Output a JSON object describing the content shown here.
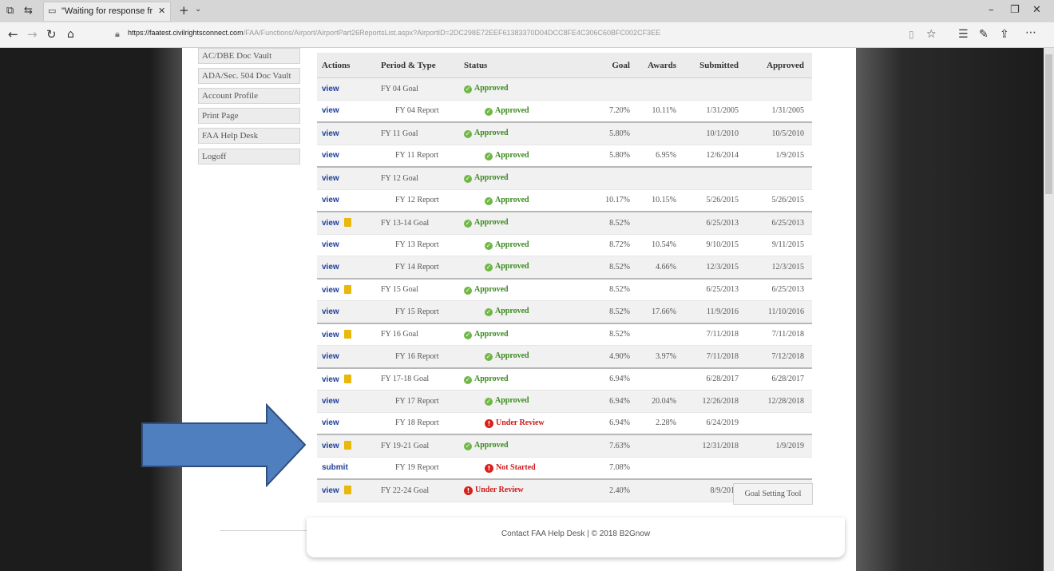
{
  "browser": {
    "tab_title": "\"Waiting for response fr",
    "url_host": "https://faatest.civilrightsconnect.com",
    "url_path": "/FAA/Functions/Airport/AirportPart26ReportsList.aspx?AirportID=2DC298E72EEF61383370D04DCC8FE4C306C60BFC002CF3EE"
  },
  "side_menu": {
    "items": [
      "AC/DBE Doc Vault",
      "ADA/Sec. 504 Doc Vault",
      "Account Profile",
      "Print Page",
      "FAA Help Desk",
      "Logoff"
    ]
  },
  "table": {
    "headers": [
      "Actions",
      "Period & Type",
      "Status",
      "Goal",
      "Awards",
      "Submitted",
      "Approved"
    ],
    "rows": [
      {
        "action": "view",
        "doc": false,
        "period": "FY 04 Goal",
        "indent": false,
        "status": "Approved",
        "state": "ok",
        "goal": "",
        "awards": "",
        "submitted": "",
        "approved": ""
      },
      {
        "action": "view",
        "doc": false,
        "period": "FY 04 Report",
        "indent": true,
        "status": "Approved",
        "state": "ok",
        "goal": "7.20%",
        "awards": "10.11%",
        "submitted": "1/31/2005",
        "approved": "1/31/2005"
      },
      {
        "action": "view",
        "doc": false,
        "period": "FY 11 Goal",
        "indent": false,
        "status": "Approved",
        "state": "ok",
        "goal": "5.80%",
        "awards": "",
        "submitted": "10/1/2010",
        "approved": "10/5/2010"
      },
      {
        "action": "view",
        "doc": false,
        "period": "FY 11 Report",
        "indent": true,
        "status": "Approved",
        "state": "ok",
        "goal": "5.80%",
        "awards": "6.95%",
        "submitted": "12/6/2014",
        "approved": "1/9/2015"
      },
      {
        "action": "view",
        "doc": false,
        "period": "FY 12 Goal",
        "indent": false,
        "status": "Approved",
        "state": "ok",
        "goal": "",
        "awards": "",
        "submitted": "",
        "approved": ""
      },
      {
        "action": "view",
        "doc": false,
        "period": "FY 12 Report",
        "indent": true,
        "status": "Approved",
        "state": "ok",
        "goal": "10.17%",
        "awards": "10.15%",
        "submitted": "5/26/2015",
        "approved": "5/26/2015"
      },
      {
        "action": "view",
        "doc": true,
        "period": "FY 13-14 Goal",
        "indent": false,
        "status": "Approved",
        "state": "ok",
        "goal": "8.52%",
        "awards": "",
        "submitted": "6/25/2013",
        "approved": "6/25/2013"
      },
      {
        "action": "view",
        "doc": false,
        "period": "FY 13 Report",
        "indent": true,
        "status": "Approved",
        "state": "ok",
        "goal": "8.72%",
        "awards": "10.54%",
        "submitted": "9/10/2015",
        "approved": "9/11/2015"
      },
      {
        "action": "view",
        "doc": false,
        "period": "FY 14 Report",
        "indent": true,
        "status": "Approved",
        "state": "ok",
        "goal": "8.52%",
        "awards": "4.66%",
        "submitted": "12/3/2015",
        "approved": "12/3/2015"
      },
      {
        "action": "view",
        "doc": true,
        "period": "FY 15 Goal",
        "indent": false,
        "status": "Approved",
        "state": "ok",
        "goal": "8.52%",
        "awards": "",
        "submitted": "6/25/2013",
        "approved": "6/25/2013"
      },
      {
        "action": "view",
        "doc": false,
        "period": "FY 15 Report",
        "indent": true,
        "status": "Approved",
        "state": "ok",
        "goal": "8.52%",
        "awards": "17.66%",
        "submitted": "11/9/2016",
        "approved": "11/10/2016"
      },
      {
        "action": "view",
        "doc": true,
        "period": "FY 16 Goal",
        "indent": false,
        "status": "Approved",
        "state": "ok",
        "goal": "8.52%",
        "awards": "",
        "submitted": "7/11/2018",
        "approved": "7/11/2018"
      },
      {
        "action": "view",
        "doc": false,
        "period": "FY 16 Report",
        "indent": true,
        "status": "Approved",
        "state": "ok",
        "goal": "4.90%",
        "awards": "3.97%",
        "submitted": "7/11/2018",
        "approved": "7/12/2018"
      },
      {
        "action": "view",
        "doc": true,
        "period": "FY 17-18 Goal",
        "indent": false,
        "status": "Approved",
        "state": "ok",
        "goal": "6.94%",
        "awards": "",
        "submitted": "6/28/2017",
        "approved": "6/28/2017"
      },
      {
        "action": "view",
        "doc": false,
        "period": "FY 17 Report",
        "indent": true,
        "status": "Approved",
        "state": "ok",
        "goal": "6.94%",
        "awards": "20.04%",
        "submitted": "12/26/2018",
        "approved": "12/28/2018"
      },
      {
        "action": "view",
        "doc": false,
        "period": "FY 18 Report",
        "indent": true,
        "status": "Under Review",
        "state": "warn",
        "goal": "6.94%",
        "awards": "2.28%",
        "submitted": "6/24/2019",
        "approved": ""
      },
      {
        "action": "view",
        "doc": true,
        "period": "FY 19-21 Goal",
        "indent": false,
        "status": "Approved",
        "state": "ok",
        "goal": "7.63%",
        "awards": "",
        "submitted": "12/31/2018",
        "approved": "1/9/2019"
      },
      {
        "action": "submit",
        "doc": false,
        "period": "FY 19 Report",
        "indent": true,
        "status": "Not Started",
        "state": "warn",
        "goal": "7.08%",
        "awards": "",
        "submitted": "",
        "approved": ""
      },
      {
        "action": "view",
        "doc": true,
        "period": "FY 22-24 Goal",
        "indent": false,
        "status": "Under Review",
        "state": "warn",
        "goal": "2.40%",
        "awards": "",
        "submitted": "8/9/2019",
        "approved": ""
      }
    ]
  },
  "goal_tool_button": "Goal Setting Tool",
  "footer": {
    "help_link": "Contact FAA Help Desk",
    "copyright": "© 2018 B2Gnow"
  },
  "colors": {
    "link": "#1d3f99",
    "approved": "#3b8a1e",
    "alert": "#cc1a1a",
    "arrow": "#4f7fbf"
  }
}
